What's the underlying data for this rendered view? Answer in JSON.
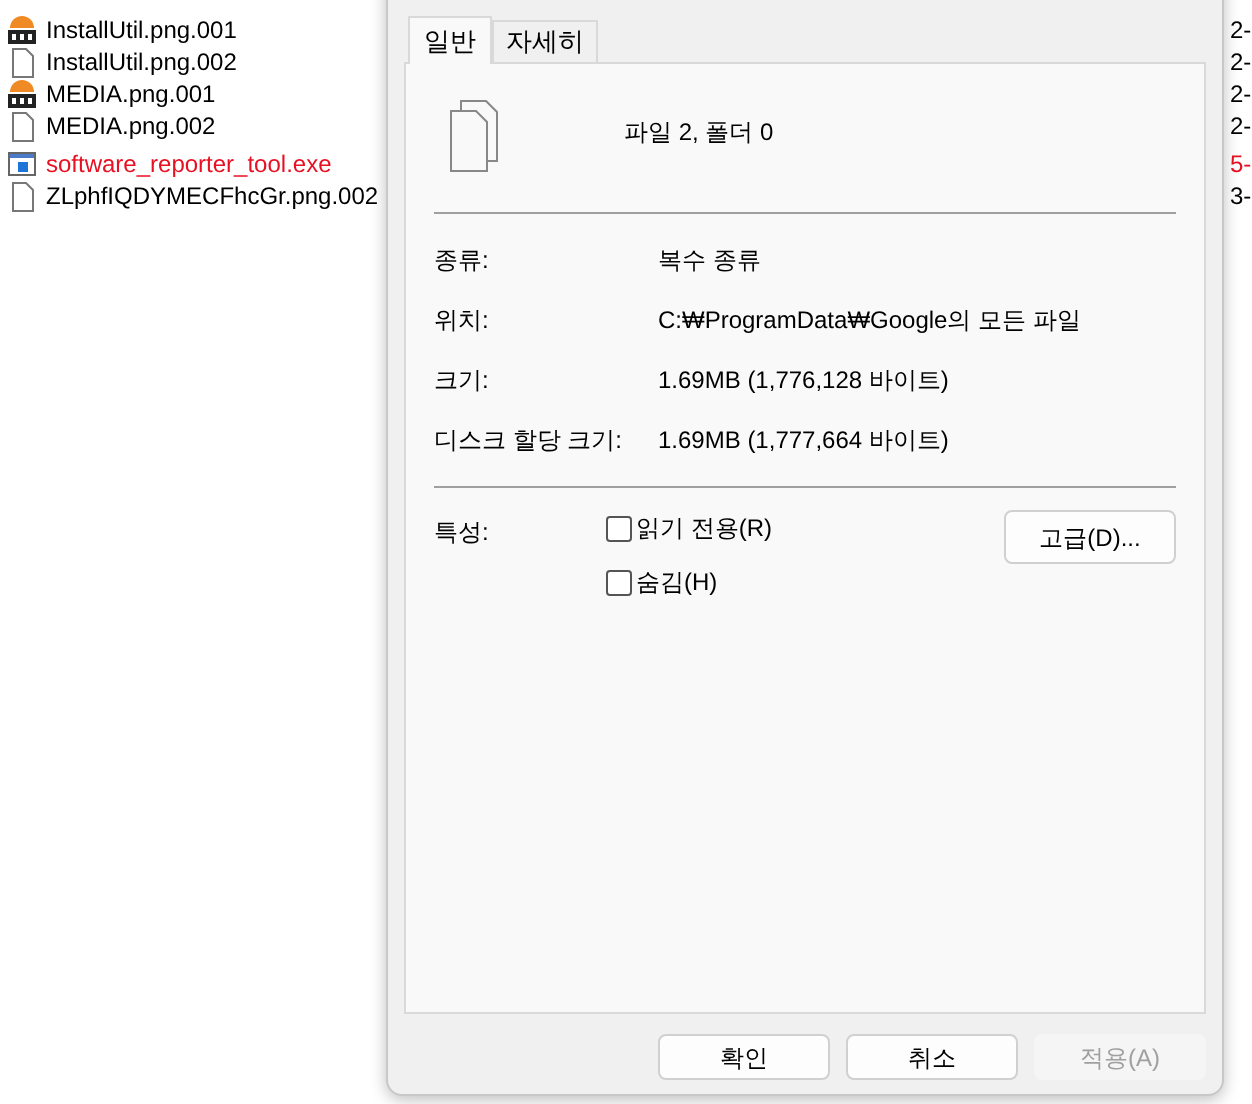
{
  "explorer": {
    "rows": [
      {
        "name": "InstallUtil.png.001",
        "kind": "archive",
        "column_2": "2-",
        "color": "#000000"
      },
      {
        "name": "InstallUtil.png.002",
        "kind": "file",
        "column_2": "2-",
        "color": "#000000"
      },
      {
        "name": "MEDIA.png.001",
        "kind": "archive",
        "column_2": "2-",
        "color": "#000000"
      },
      {
        "name": "MEDIA.png.002",
        "kind": "file",
        "column_2": "2-",
        "color": "#000000"
      },
      {
        "name": "software_reporter_tool.exe",
        "kind": "exe",
        "column_2": "5-",
        "color": "#e81123"
      },
      {
        "name": "ZLphfIQDYMECFhcGr.png.002",
        "kind": "file",
        "column_2": "3-",
        "color": "#000000"
      }
    ]
  },
  "dialog": {
    "tabs": [
      {
        "label": "일반",
        "selected": true
      },
      {
        "label": "자세히",
        "selected": false
      }
    ],
    "summary": "파일 2, 폴더 0",
    "properties": [
      {
        "label": "종류:",
        "value": "복수 종류"
      },
      {
        "label": "위치:",
        "value": "C:₩ProgramData₩Google의 모든 파일"
      },
      {
        "label": "크기:",
        "value": "1.69MB (1,776,128 바이트)"
      },
      {
        "label": "디스크 할당 크기:",
        "value": "1.69MB (1,777,664 바이트)"
      }
    ],
    "attributes_label": "특성:",
    "attributes": [
      {
        "label": "읽기 전용(R)",
        "checked": false
      },
      {
        "label": "숨김(H)",
        "checked": false
      }
    ],
    "advanced_button": "고급(D)...",
    "buttons": [
      {
        "label": "확인",
        "disabled": false
      },
      {
        "label": "취소",
        "disabled": false
      },
      {
        "label": "적용(A)",
        "disabled": true
      }
    ]
  }
}
